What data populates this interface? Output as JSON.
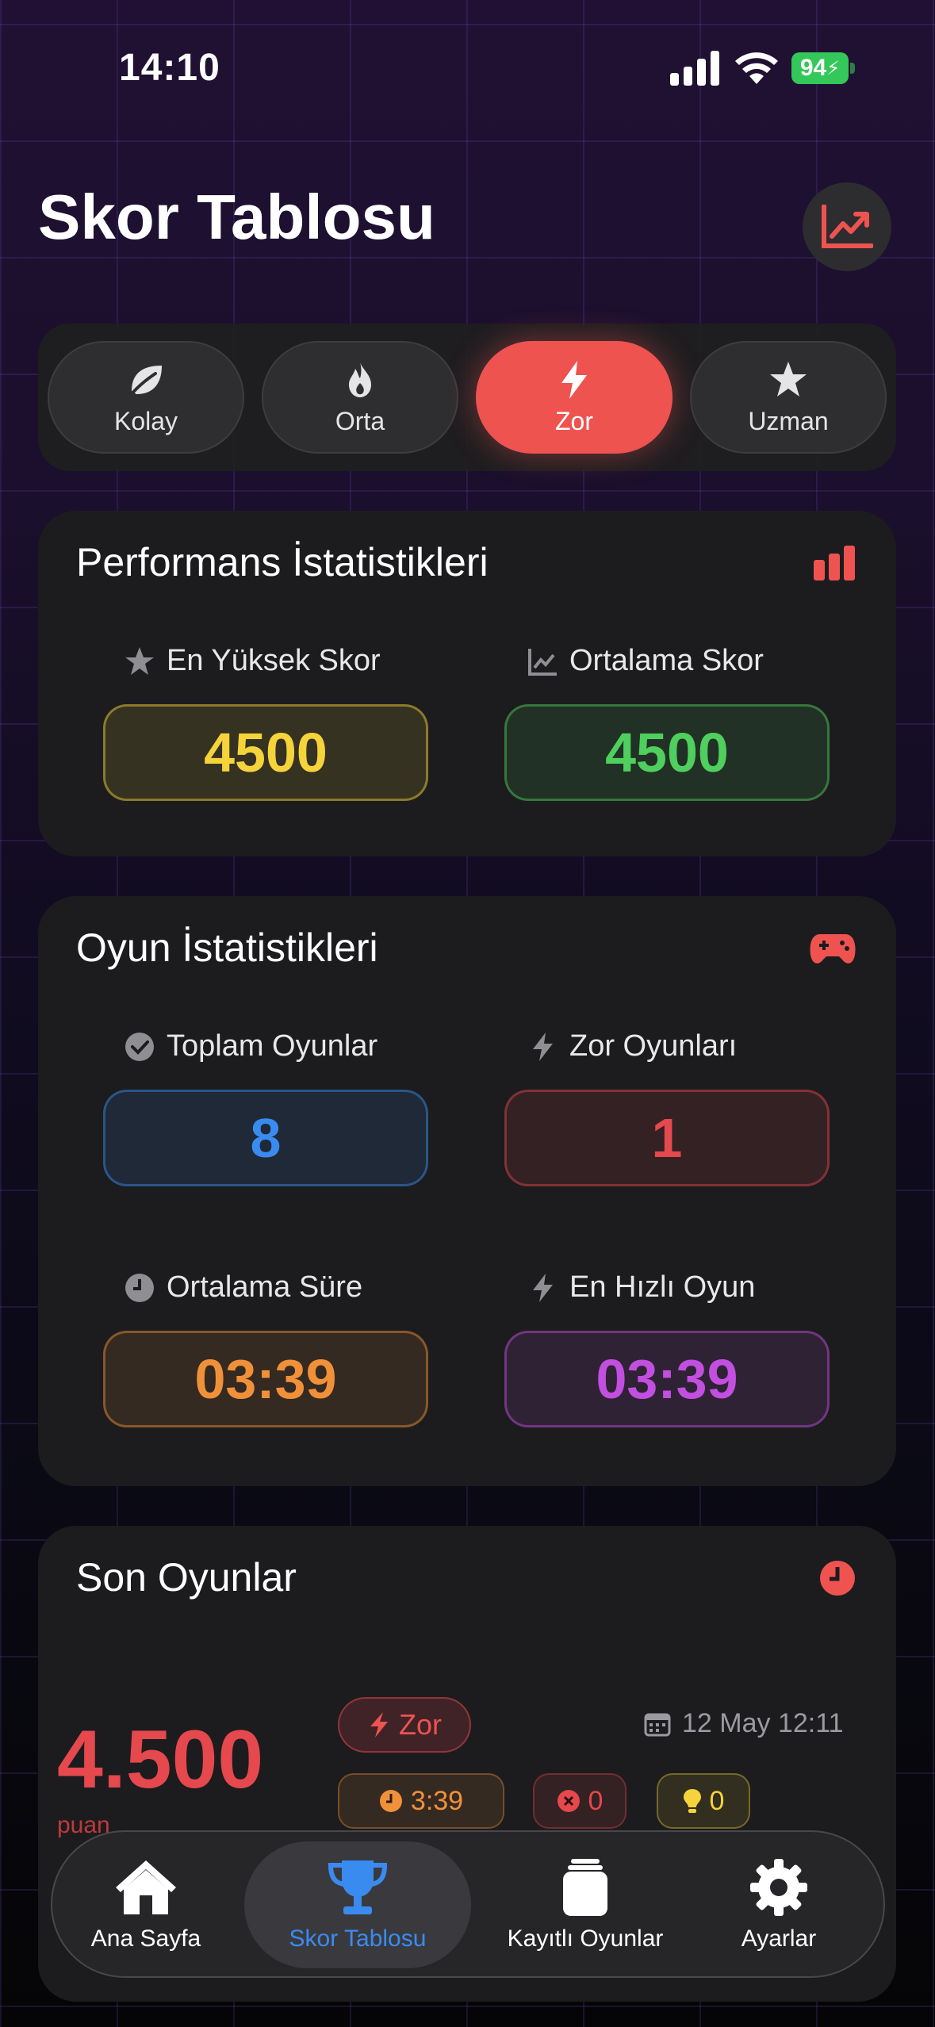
{
  "status_bar": {
    "time": "14:10",
    "battery": "94"
  },
  "header": {
    "title": "Skor Tablosu",
    "chart_button_icon": "chart-trending-up-icon"
  },
  "difficulty": {
    "options": [
      {
        "label": "Kolay",
        "icon": "leaf-icon"
      },
      {
        "label": "Orta",
        "icon": "flame-icon"
      },
      {
        "label": "Zor",
        "icon": "bolt-icon"
      },
      {
        "label": "Uzman",
        "icon": "star-icon"
      }
    ],
    "selected": "Zor"
  },
  "performance": {
    "title": "Performans İstatistikleri",
    "high_score_label": "En Yüksek Skor",
    "high_score": "4500",
    "avg_score_label": "Ortalama Skor",
    "avg_score": "4500"
  },
  "game_stats": {
    "title": "Oyun İstatistikleri",
    "total_label": "Toplam Oyunlar",
    "total": "8",
    "hard_label": "Zor Oyunları",
    "hard": "1",
    "avg_time_label": "Ortalama Süre",
    "avg_time": "03:39",
    "fastest_label": "En Hızlı Oyun",
    "fastest": "03:39"
  },
  "recent": {
    "title": "Son Oyunlar",
    "score": "4.500",
    "unit": "puan",
    "difficulty": "Zor",
    "date": "12 May 12:11",
    "time": "3:39",
    "mistakes": "0",
    "hints": "0"
  },
  "tabbar": {
    "items": [
      {
        "label": "Ana Sayfa",
        "icon": "home-icon"
      },
      {
        "label": "Skor Tablosu",
        "icon": "trophy-icon"
      },
      {
        "label": "Kayıtlı Oyunlar",
        "icon": "archive-icon"
      },
      {
        "label": "Ayarlar",
        "icon": "gear-icon"
      }
    ],
    "active": "Skor Tablosu"
  },
  "colors": {
    "accent_red": "#ee5350",
    "gold": "#f5d33b",
    "green": "#4fcf5e",
    "blue": "#3a8bf0",
    "orange": "#f0913a",
    "purple": "#c24fe0",
    "active_tab": "#3a8bf0"
  }
}
